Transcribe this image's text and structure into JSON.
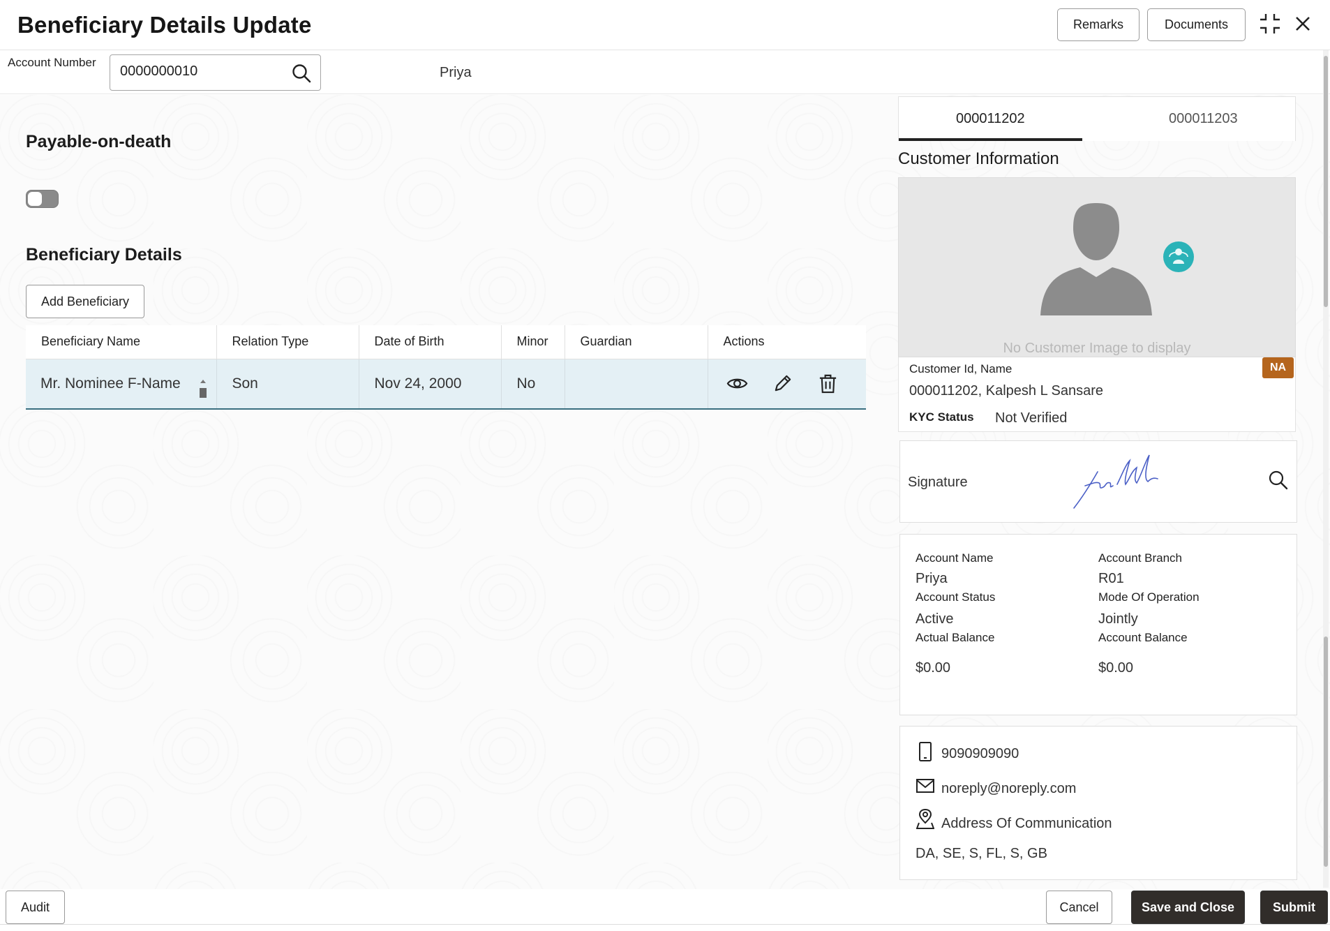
{
  "header": {
    "title": "Beneficiary Details Update",
    "remarks_label": "Remarks",
    "documents_label": "Documents"
  },
  "account": {
    "label": "Account Number",
    "value": "0000000010",
    "name": "Priya"
  },
  "pod": {
    "title": "Payable-on-death",
    "enabled": false
  },
  "beneficiary": {
    "title": "Beneficiary Details",
    "add_label": "Add Beneficiary",
    "columns": [
      "Beneficiary Name",
      "Relation Type",
      "Date of Birth",
      "Minor",
      "Guardian",
      "Actions"
    ],
    "rows": [
      {
        "name": "Mr. Nominee F-Name",
        "relation": "Son",
        "dob": "Nov 24, 2000",
        "minor": "No",
        "guardian": ""
      }
    ]
  },
  "customer": {
    "tabs": [
      "000011202",
      "000011203"
    ],
    "section_title": "Customer Information",
    "no_image_text": "No Customer Image to display",
    "id_name_label": "Customer Id, Name",
    "badge": "NA",
    "id_name_value": "000011202, Kalpesh L Sansare",
    "kyc_label": "KYC Status",
    "kyc_value": "Not Verified",
    "signature_label": "Signature"
  },
  "account_details": {
    "account_name_label": "Account Name",
    "account_name": "Priya",
    "account_branch_label": "Account Branch",
    "account_branch": "R01",
    "account_status_label": "Account Status",
    "account_status": "Active",
    "mode_label": "Mode Of Operation",
    "mode": "Jointly",
    "actual_balance_label": "Actual Balance",
    "actual_balance": "$0.00",
    "account_balance_label": "Account Balance",
    "account_balance": "$0.00"
  },
  "contact": {
    "phone": "9090909090",
    "email": "noreply@noreply.com",
    "address_label": "Address Of Communication",
    "address": "DA, SE, S, FL, S, GB"
  },
  "footer": {
    "audit_label": "Audit",
    "cancel_label": "Cancel",
    "save_close_label": "Save and Close",
    "submit_label": "Submit"
  },
  "colors": {
    "primary_button": "#312d2a",
    "badge": "#b5651d",
    "row_selected": "#e4f0f5",
    "support_icon": "#2bb3b8"
  }
}
